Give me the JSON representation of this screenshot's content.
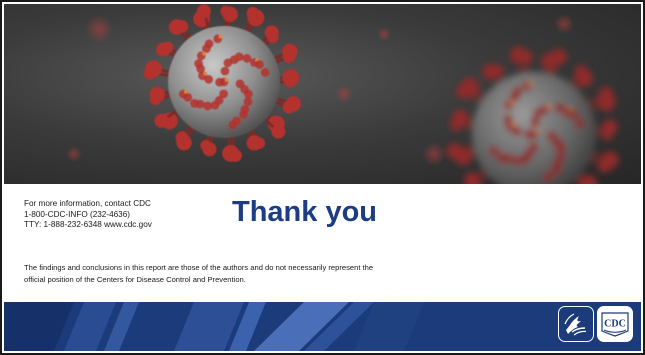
{
  "slide": {
    "contact_lines": [
      "For more information, contact CDC",
      "1-800-CDC-INFO (232-4636)",
      "TTY:  1-888-232-6348    www.cdc.gov"
    ],
    "thank_you": "Thank you",
    "disclaimer_lines": [
      "The findings and conclusions in this report are those of the authors and do not necessarily represent the",
      "official position of the Centers for Disease Control and Prevention."
    ]
  },
  "logos": {
    "hhs_icon": "hhs-eagle-icon",
    "cdc_text": "CDC"
  },
  "colors": {
    "title_blue": "#1c3d82",
    "band_blue": "#1b3b7a",
    "virus_red": "#b4312d",
    "virus_grey": "#8f8f8f",
    "hero_dark": "#2a2a2a"
  }
}
